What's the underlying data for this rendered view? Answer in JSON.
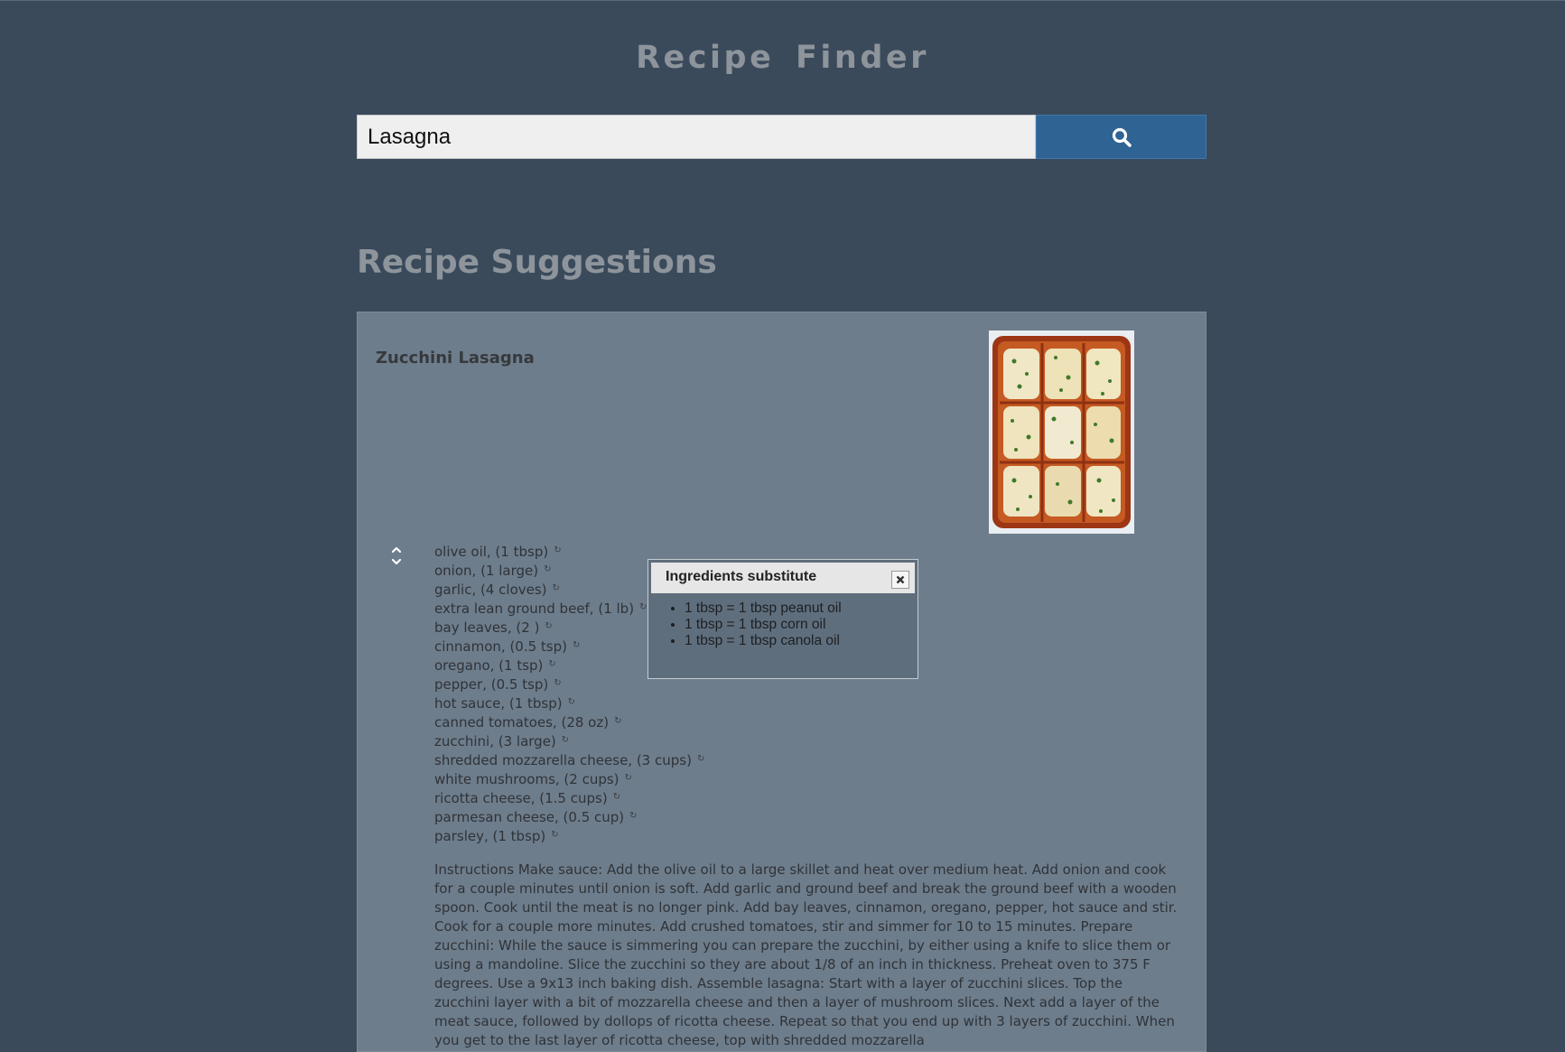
{
  "app": {
    "title": "Recipe Finder"
  },
  "search": {
    "value": "Lasagna",
    "button_icon": "search-icon"
  },
  "section": {
    "title": "Recipe Suggestions"
  },
  "recipe": {
    "title": "Zucchini Lasagna",
    "image_icon": "lasagna-photo",
    "ingredients": [
      "olive oil, (1 tbsp)",
      "onion, (1 large)",
      "garlic, (4 cloves)",
      "extra lean ground beef, (1 lb)",
      "bay leaves, (2 )",
      "cinnamon, (0.5 tsp)",
      "oregano, (1 tsp)",
      "pepper, (0.5 tsp)",
      "hot sauce, (1 tbsp)",
      "canned tomatoes, (28 oz)",
      "zucchini, (3 large)",
      "shredded mozzarella cheese, (3 cups)",
      "white mushrooms, (2 cups)",
      "ricotta cheese, (1.5 cups)",
      "parmesan cheese, (0.5 cup)",
      "parsley, (1 tbsp)"
    ],
    "instructions": "Instructions Make sauce: Add the olive oil to a large skillet and heat over medium heat. Add onion and cook for a couple minutes until onion is soft. Add garlic and ground beef and break the ground beef with a wooden spoon. Cook until the meat is no longer pink. Add bay leaves, cinnamon, oregano, pepper, hot sauce and stir. Cook for a couple more minutes. Add crushed tomatoes, stir and simmer for 10 to 15 minutes. Prepare zucchini: While the sauce is simmering you can prepare the zucchini, by either using a knife to slice them or using a mandoline. Slice the zucchini so they are about 1/8 of an inch in thickness. Preheat oven to 375 F degrees. Use a 9x13 inch baking dish. Assemble lasagna: Start with a layer of zucchini slices. Top the zucchini layer with a bit of mozzarella cheese and then a layer of mushroom slices. Next add a layer of the meat sauce, followed by dollops of ricotta cheese. Repeat so that you end up with 3 layers of zucchini. When you get to the last layer of ricotta cheese, top with shredded mozzarella"
  },
  "popup": {
    "title": "Ingredients substitute",
    "items": [
      "1 tbsp = 1 tbsp peanut oil",
      "1 tbsp = 1 tbsp corn oil",
      "1 tbsp = 1 tbsp canola oil"
    ]
  },
  "colors": {
    "background": "#3a4a5b",
    "card": "#6e7d8c",
    "accent": "#2e6393",
    "heading": "#8d949b"
  }
}
